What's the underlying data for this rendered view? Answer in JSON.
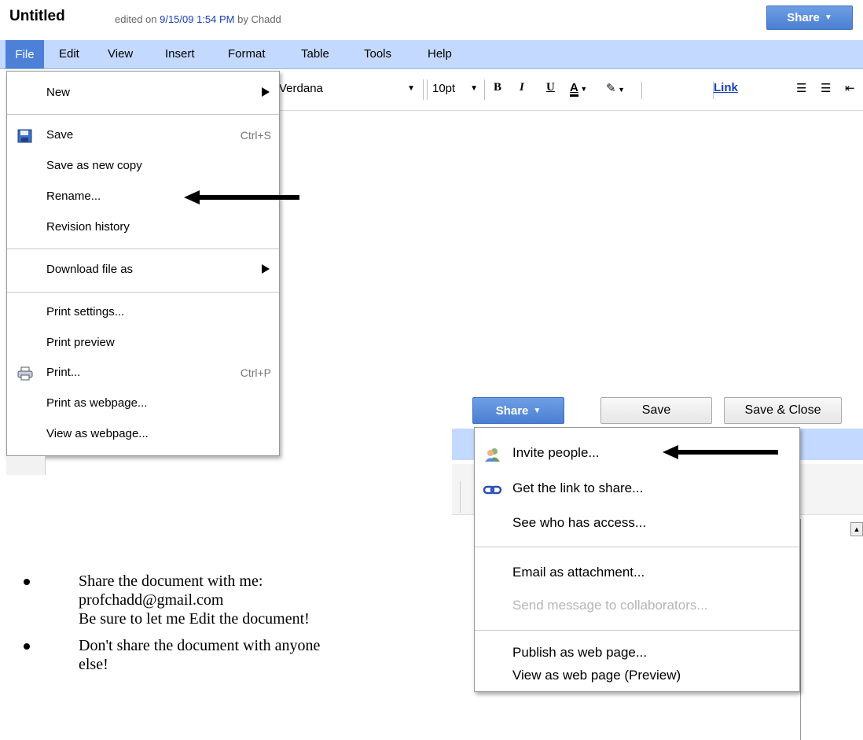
{
  "header": {
    "title": "Untitled",
    "edited_prefix": "edited on ",
    "edited_date": "9/15/09 1:54 PM",
    "edited_by": " by Chadd",
    "share_label": "Share"
  },
  "menubar": {
    "items": [
      "File",
      "Edit",
      "View",
      "Insert",
      "Format",
      "Table",
      "Tools",
      "Help"
    ]
  },
  "toolbar": {
    "font": "Verdana",
    "font_size": "10pt",
    "bold": "B",
    "italic": "I",
    "underline": "U",
    "text_color": "A",
    "link": "Link"
  },
  "file_menu": {
    "new": "New",
    "save": "Save",
    "save_shortcut": "Ctrl+S",
    "save_copy": "Save as new copy",
    "rename": "Rename...",
    "revision_history": "Revision history",
    "download": "Download file as",
    "print_settings": "Print settings...",
    "print_preview": "Print preview",
    "print": "Print...",
    "print_shortcut": "Ctrl+P",
    "print_webpage": "Print as webpage...",
    "view_webpage": "View as webpage..."
  },
  "action_bar": {
    "share_label": "Share",
    "save_label": "Save",
    "save_close_label": "Save & Close"
  },
  "share_menu": {
    "invite": "Invite people...",
    "get_link": "Get the link to share...",
    "see_access": "See who has access...",
    "email_attachment": "Email as attachment...",
    "send_message": "Send message to collaborators...",
    "publish": "Publish as web page...",
    "view_preview": "View as web page (Preview)"
  },
  "instructions": {
    "line1": "Share the document with me:",
    "line2": "profchadd@gmail.com",
    "line3": "Be sure to let me Edit the document!",
    "line4": "Don't share the document with anyone",
    "line5": "else!"
  },
  "colors": {
    "accent_blue": "#4d80d7",
    "menubar_blue": "#c3d9ff",
    "link_blue": "#1a3fb8"
  }
}
